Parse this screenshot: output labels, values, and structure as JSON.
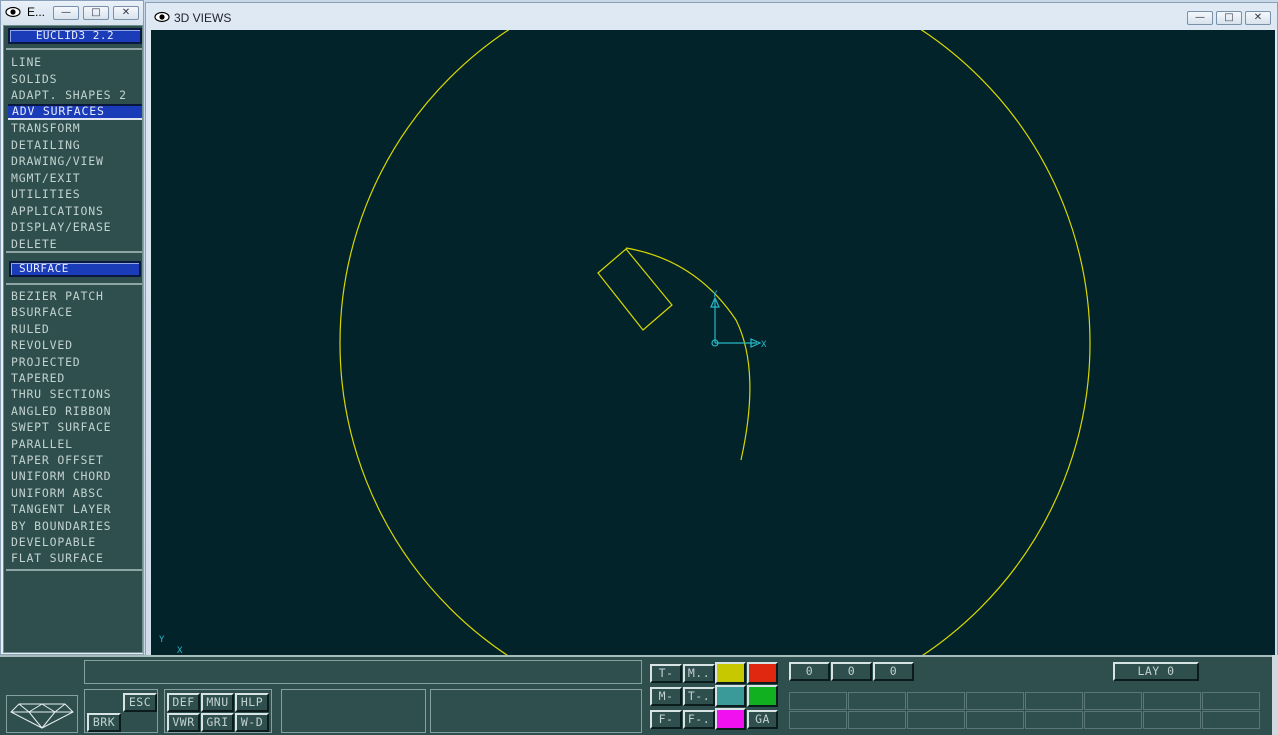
{
  "menu_window": {
    "title": "E...",
    "minimize": "—",
    "maximize": "□",
    "close": "✕"
  },
  "app_version": "EUCLID3 2.2",
  "main_menu": [
    "LINE",
    "SOLIDS",
    "ADAPT. SHAPES 2",
    "ADV SURFACES",
    "TRANSFORM",
    "DETAILING",
    "DRAWING/VIEW",
    "MGMT/EXIT",
    "UTILITIES",
    "APPLICATIONS",
    "DISPLAY/ERASE",
    "DELETE"
  ],
  "selected_main_menu": "ADV SURFACES",
  "submenu_title": "SURFACE",
  "surface_menu": [
    "BEZIER PATCH",
    "BSURFACE",
    "RULED",
    "REVOLVED",
    "PROJECTED",
    "TAPERED",
    "THRU SECTIONS",
    "ANGLED RIBBON",
    "SWEPT SURFACE",
    "PARALLEL",
    "TAPER  OFFSET",
    "UNIFORM CHORD",
    "UNIFORM ABSC",
    "TANGENT LAYER",
    "BY BOUNDARIES",
    "DEVELOPABLE",
    "FLAT SURFACE"
  ],
  "view_window": {
    "title": "3D VIEWS",
    "minimize": "—",
    "maximize": "□",
    "close": "✕"
  },
  "viewport": {
    "background": "#03232a",
    "geometry_color": "#d8d800",
    "axis_color": "#27b8c8",
    "axis_x_label": "X",
    "axis_y_label": "Y",
    "corner_y_label": "Y",
    "corner_x_label": "X"
  },
  "bottom": {
    "logo_icon": "diamond-icon",
    "esc": "ESC",
    "brk": "BRK",
    "def": "DEF",
    "mnu": "MNU",
    "hlp": "HLP",
    "vwr": "VWR",
    "gri": "GRI",
    "wd": "W-D",
    "mode_buttons": [
      [
        "T-",
        "M.."
      ],
      [
        "M-",
        "T-."
      ],
      [
        "F-",
        "F-."
      ]
    ],
    "ga": "GA",
    "swatches": [
      "#c8c800",
      "#e02810",
      "#3a9a9a",
      "#10b020",
      "#f010f0"
    ],
    "counters": [
      "0",
      "0",
      "0"
    ],
    "layer": "LAY 0"
  }
}
